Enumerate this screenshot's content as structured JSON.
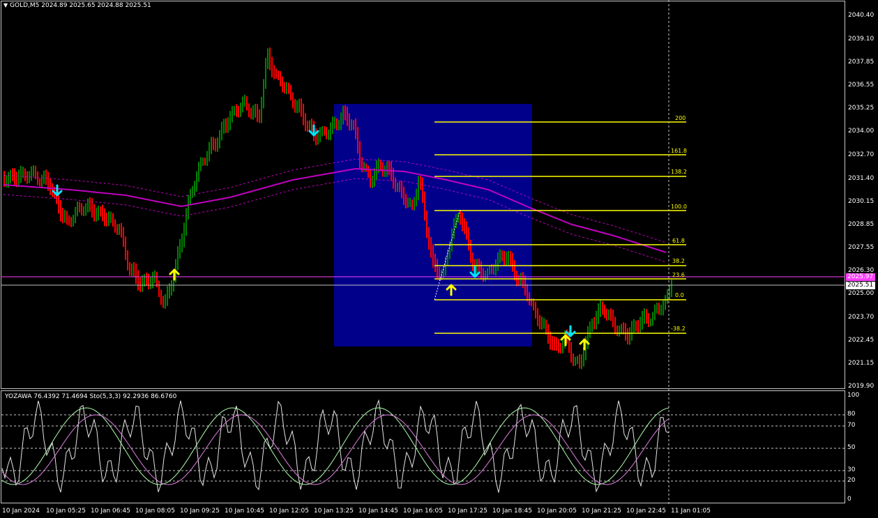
{
  "chart": {
    "symbol_title": "GOLD,M5  2024.89 2025.65 2024.88 2025.51",
    "indicator_title": "YOZAWA 76.4392 71.4694  Sto(5,3,3) 92.2936 86.6760",
    "dropdown_icon": "triangle-down-icon",
    "colors": {
      "bull": "#008000",
      "bear": "#ff0000",
      "ma": "#c000c0",
      "fib": "#ffff00",
      "range_box": "#00008b",
      "arrow_up": "#ffff00",
      "arrow_down": "#00e5ff",
      "bid_line": "#ff40ff",
      "ask_line": "#c0c0c0"
    },
    "price_labels": [
      "2040.40",
      "2039.10",
      "2037.85",
      "2036.55",
      "2035.25",
      "2034.00",
      "2032.70",
      "2031.40",
      "2030.15",
      "2028.85",
      "2027.55",
      "2026.30",
      "2025.00",
      "2023.70",
      "2022.45",
      "2021.15",
      "2019.90"
    ],
    "current_price_magenta": "2025.97",
    "current_price_white": "2025.51",
    "indicator_levels": [
      "100",
      "80",
      "70",
      "50",
      "30",
      "20",
      "0"
    ],
    "time_labels": [
      "10 Jan 2024",
      "10 Jan 05:25",
      "10 Jan 06:45",
      "10 Jan 08:05",
      "10 Jan 09:25",
      "10 Jan 10:45",
      "10 Jan 12:05",
      "10 Jan 13:25",
      "10 Jan 14:45",
      "10 Jan 16:05",
      "10 Jan 17:25",
      "10 Jan 18:45",
      "10 Jan 20:05",
      "10 Jan 21:25",
      "10 Jan 22:45",
      "11 Jan 01:05"
    ],
    "fib_levels": [
      "200",
      "161.8",
      "138.2",
      "100.0",
      "61.8",
      "38.2",
      "23.6",
      "0.0",
      "-38.2"
    ]
  }
}
